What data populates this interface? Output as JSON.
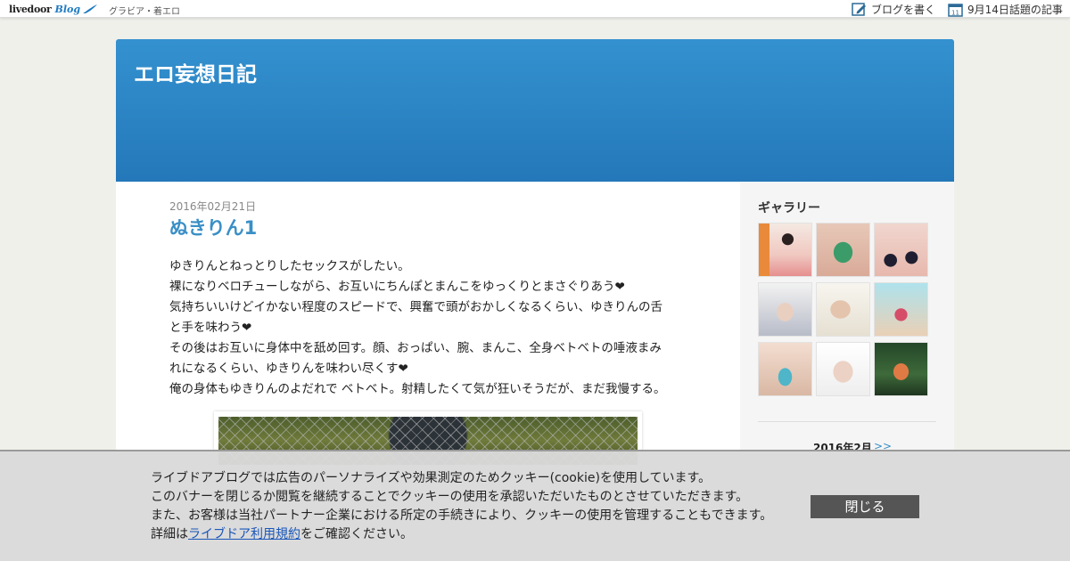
{
  "topbar": {
    "logo_text": "livedoor",
    "logo_blog": "Blog",
    "category": "グラビア・着エロ",
    "write_label": "ブログを書く",
    "calendar_day": "11",
    "topic_label": "9月14日話題の記事"
  },
  "header": {
    "title": "エロ妄想日記"
  },
  "post": {
    "date": "2016年02月21日",
    "title": "ぬきりん1",
    "body": [
      "ゆきりんとねっとりしたセックスがしたい。",
      "裸になりベロチューしながら、お互いにちんぽとまんこをゆっくりとまさぐりあう❤",
      "気持ちいいけどイかない程度のスピードで、興奮で頭がおかしくなるくらい、ゆきりんの舌",
      "と手を味わう❤",
      "その後はお互いに身体中を舐め回す。顔、おっぱい、腕、まんこ、全身ベトベトの唾液まみ",
      "れになるくらい、ゆきりんを味わい尽くす❤",
      "俺の身体もゆきりんのよだれで ベトベト。射精したくて気が狂いそうだが、まだ我慢する。"
    ]
  },
  "sidebar": {
    "gallery_title": "ギャラリー",
    "calendar_month": "2016年2月",
    "calendar_next": ">>"
  },
  "cookie": {
    "line1": "ライブドアブログでは広告のパーソナライズや効果測定のためクッキー(cookie)を使用しています。",
    "line2": "このバナーを閉じるか閲覧を継続することでクッキーの使用を承認いただいたものとさせていただきます。",
    "line3": "また、お客様は当社パートナー企業における所定の手続きにより、クッキーの使用を管理することもできます。",
    "line4_prefix": "詳細は",
    "line4_link": "ライブドア利用規約",
    "line4_suffix": "をご確認ください。",
    "close_label": "閉じる"
  },
  "colors": {
    "accent": "#2a84c4",
    "title_blue": "#3a8fc6",
    "close_bg": "#555555"
  }
}
